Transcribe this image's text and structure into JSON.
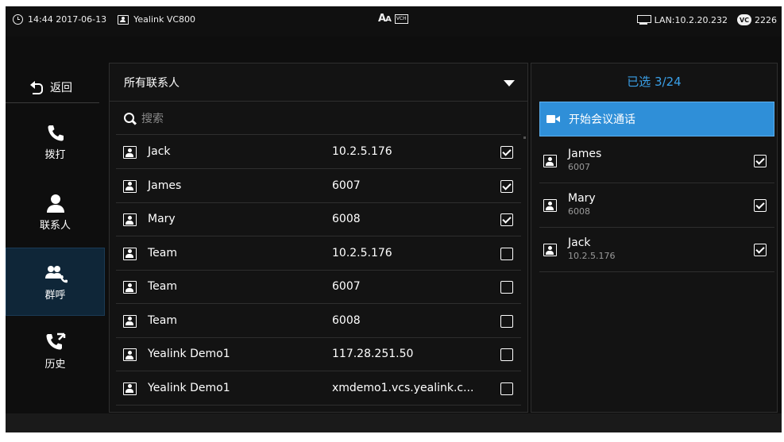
{
  "status_bar": {
    "datetime": "14:44 2017-06-13",
    "device": "Yealink VC800",
    "font_icon": "Aᴀ",
    "vch_label": "VCH",
    "lan": "LAN:10.2.20.232",
    "vc_badge": "VC",
    "vc_number": "2226"
  },
  "nav": {
    "back_label": "返回",
    "items": [
      {
        "label": "拨打",
        "icon": "phone-icon",
        "active": false
      },
      {
        "label": "联系人",
        "icon": "contact-person-icon",
        "active": false
      },
      {
        "label": "群呼",
        "icon": "group-call-icon",
        "active": true
      },
      {
        "label": "历史",
        "icon": "history-icon",
        "active": false
      }
    ]
  },
  "list": {
    "filter_label": "所有联系人",
    "search_placeholder": "搜索",
    "rows": [
      {
        "name": "Jack",
        "number": "10.2.5.176",
        "checked": true
      },
      {
        "name": "James",
        "number": "6007",
        "checked": true
      },
      {
        "name": "Mary",
        "number": "6008",
        "checked": true
      },
      {
        "name": "Team",
        "number": "10.2.5.176",
        "checked": false
      },
      {
        "name": "Team",
        "number": "6007",
        "checked": false
      },
      {
        "name": "Team",
        "number": "6008",
        "checked": false
      },
      {
        "name": "Yealink Demo1",
        "number": "117.28.251.50",
        "checked": false
      },
      {
        "name": "Yealink Demo1",
        "number": "xmdemo1.vcs.yealink.c...",
        "checked": false
      }
    ]
  },
  "selected": {
    "header": "已选 3/24",
    "start_button_label": "开始会议通话",
    "rows": [
      {
        "name": "James",
        "number": "6007",
        "checked": true
      },
      {
        "name": "Mary",
        "number": "6008",
        "checked": true
      },
      {
        "name": "Jack",
        "number": "10.2.5.176",
        "checked": true
      }
    ]
  },
  "colors": {
    "accent": "#2f8fd8",
    "accent_text": "#3aa0e8",
    "background": "#0e0e0e",
    "active_nav": "#0f2638"
  }
}
